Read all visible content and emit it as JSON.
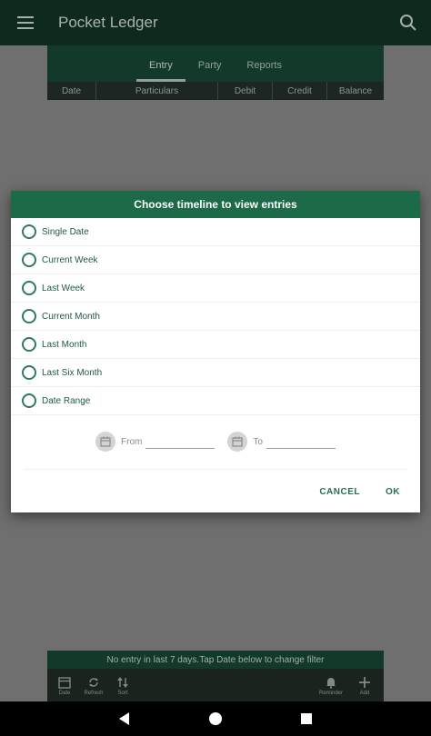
{
  "app": {
    "title": "Pocket Ledger"
  },
  "tabs": [
    {
      "label": "Entry",
      "active": true
    },
    {
      "label": "Party",
      "active": false
    },
    {
      "label": "Reports",
      "active": false
    }
  ],
  "columns": [
    "Date",
    "Particulars",
    "Debit",
    "Credit",
    "Balance"
  ],
  "dialog": {
    "title": "Choose timeline to view entries",
    "options": [
      "Single Date",
      "Current Week",
      "Last Week",
      "Current Month",
      "Last Month",
      "Last Six Month",
      "Date Range"
    ],
    "from_label": "From",
    "from_value": "",
    "to_label": "To",
    "to_value": "",
    "cancel_label": "CANCEL",
    "ok_label": "OK"
  },
  "status_text": "No entry in last 7 days.Tap Date below to change filter",
  "toolbar": {
    "date_label": "Date",
    "refresh_label": "Refresh",
    "sort_label": "Sort",
    "reminder_label": "Reminder",
    "add_label": "Add"
  },
  "colors": {
    "primary": "#1c6a48",
    "dark": "#0e2a1f",
    "accent": "#2a6e50"
  }
}
